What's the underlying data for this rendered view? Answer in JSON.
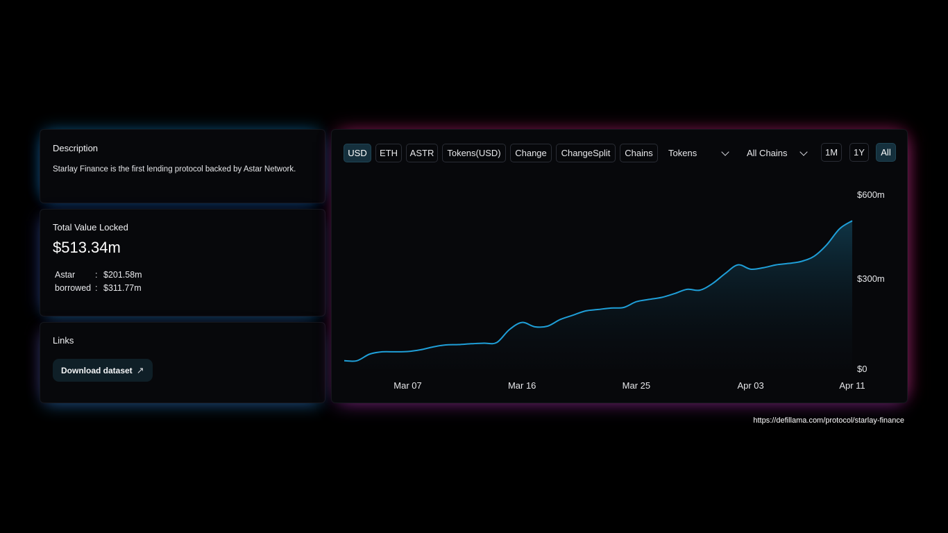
{
  "description": {
    "title": "Description",
    "text": "Starlay Finance is the first lending protocol backed by Astar Network."
  },
  "tvl": {
    "title": "Total Value Locked",
    "value": "$513.34m",
    "rows": [
      {
        "label": "Astar",
        "sep": ":",
        "value": "$201.58m"
      },
      {
        "label": "borrowed",
        "sep": ":",
        "value": "$311.77m"
      }
    ]
  },
  "links": {
    "title": "Links",
    "download_label": "Download dataset",
    "download_icon": "arrow-up-right-icon"
  },
  "toolbar": {
    "buttons": [
      "USD",
      "ETH",
      "ASTR",
      "Tokens(USD)",
      "Change",
      "ChangeSplit",
      "Chains"
    ],
    "active_button": "USD",
    "dropdowns": [
      "Tokens",
      "All Chains"
    ],
    "ranges": [
      "1M",
      "1Y",
      "All"
    ],
    "active_range": "All"
  },
  "source_url": "https://defillama.com/protocol/starlay-finance",
  "colors": {
    "line": "#1f9fd8",
    "active_button_bg": "#15303d",
    "card_bg": "#07080b"
  },
  "chart_data": {
    "type": "area",
    "x_tick_labels": [
      "Mar 07",
      "Mar 16",
      "Mar 25",
      "Apr 03",
      "Apr 11"
    ],
    "x_tick_index": [
      5,
      14,
      23,
      32,
      40
    ],
    "y_tick_labels": [
      "$0",
      "$300m",
      "$600m"
    ],
    "y_tick_values": [
      0,
      300,
      600
    ],
    "ylim": [
      0,
      600
    ],
    "y_unit": "millions USD",
    "grid": false,
    "legend": "none",
    "values": [
      27,
      27,
      50,
      58,
      58,
      59,
      65,
      75,
      82,
      83,
      86,
      88,
      90,
      135,
      160,
      145,
      147,
      170,
      185,
      200,
      205,
      210,
      212,
      232,
      240,
      247,
      260,
      275,
      272,
      295,
      330,
      360,
      345,
      350,
      360,
      365,
      372,
      390,
      430,
      485,
      513
    ]
  }
}
